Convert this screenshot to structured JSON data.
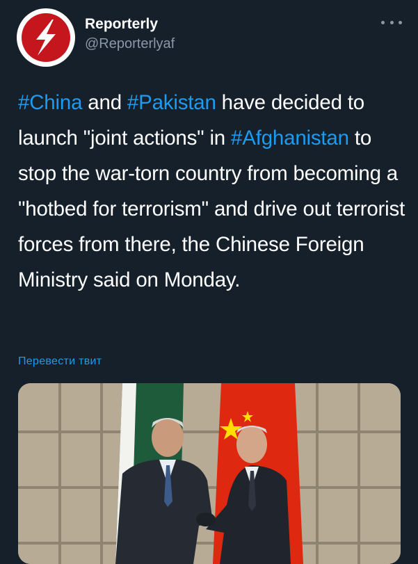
{
  "author": {
    "display_name": "Reporterly",
    "handle": "@Reporterlyaf",
    "avatar_icon": "lightning-bolt-icon",
    "avatar_color": "#c4161c"
  },
  "more_icon": "more-horizontal-icon",
  "tweet": {
    "segments": [
      {
        "text": "#China",
        "hashtag": true
      },
      {
        "text": " and ",
        "hashtag": false
      },
      {
        "text": "#Pakistan",
        "hashtag": true
      },
      {
        "text": " have decided to launch \"joint actions\" in ",
        "hashtag": false
      },
      {
        "text": "#Afghanistan",
        "hashtag": true
      },
      {
        "text": " to stop the war-torn country from becoming a \"hotbed for terrorism\" and drive out terrorist forces from there, the Chinese Foreign Ministry said on Monday.",
        "hashtag": false
      }
    ]
  },
  "translate_label": "Перевести твит",
  "colors": {
    "background": "#15202b",
    "link": "#1d9bf0",
    "secondary_text": "#8b98a5"
  }
}
